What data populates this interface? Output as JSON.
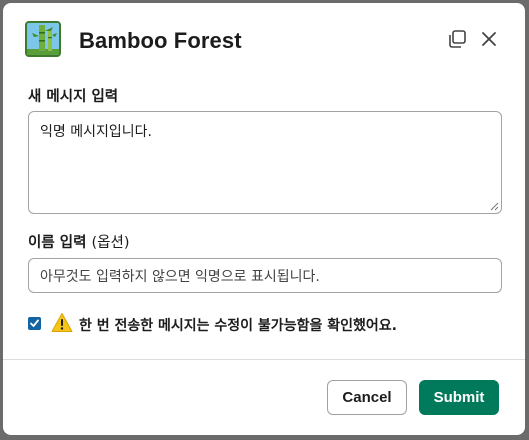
{
  "modal": {
    "title": "Bamboo Forest",
    "app_icon": "bamboo-icon",
    "header_buttons": [
      "open-in-window-icon",
      "close-icon"
    ]
  },
  "message_field": {
    "label": "새 메시지 입력",
    "value": "익명 메시지입니다."
  },
  "name_field": {
    "label": "이름 입력",
    "optional_note": "(옵션)",
    "placeholder": "아무것도 입력하지 않으면 익명으로 표시됩니다."
  },
  "confirm": {
    "checked": true,
    "icon": "warning-icon",
    "label": "한 번 전송한 메시지는 수정이 불가능함을 확인했어요."
  },
  "footer": {
    "cancel_label": "Cancel",
    "submit_label": "Submit"
  },
  "colors": {
    "submit_bg": "#007a5a",
    "checkbox_bg": "#1264a3",
    "overlay": "#6b6b6b"
  }
}
